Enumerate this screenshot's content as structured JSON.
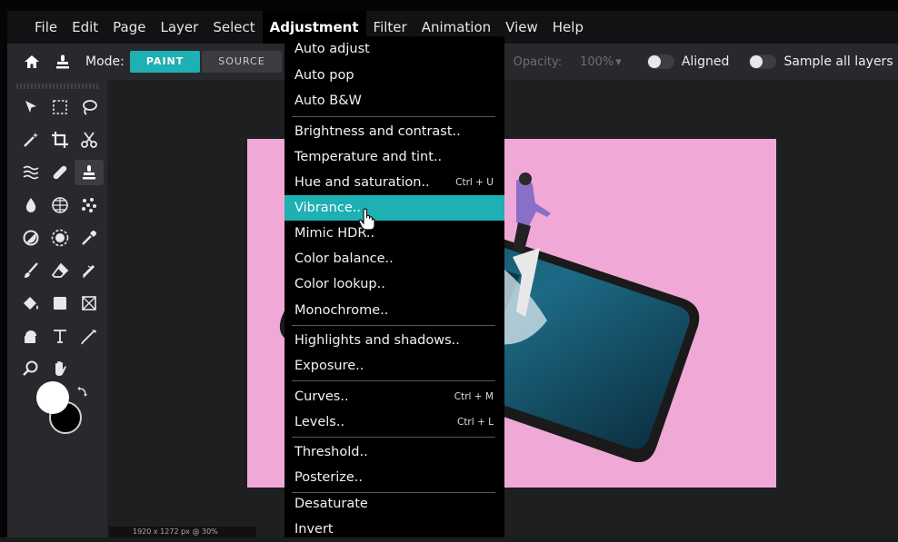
{
  "menubar": {
    "items": [
      "File",
      "Edit",
      "Page",
      "Layer",
      "Select",
      "Adjustment",
      "Filter",
      "Animation",
      "View",
      "Help"
    ],
    "active": "Adjustment"
  },
  "toolbar": {
    "home_icon": "home-icon",
    "clone_icon": "clone-stamp-icon",
    "mode_label": "Mode:",
    "mode_paint": "PAINT",
    "mode_source": "SOURCE",
    "opacity_label": "Opacity:",
    "opacity_value": "100%",
    "aligned_label": "Aligned",
    "sample_label": "Sample all layers"
  },
  "tools": [
    "move-icon",
    "marquee-icon",
    "lasso-icon",
    "magic-wand-icon",
    "crop-icon",
    "scissors-icon",
    "liquify-icon",
    "heal-icon",
    "clone-stamp-icon",
    "blur-icon",
    "sponge-icon",
    "noise-icon",
    "dodge-icon",
    "burn-icon",
    "eyedropper-icon",
    "brush-icon",
    "eraser-icon",
    "pencil-icon",
    "fill-icon",
    "shape-icon",
    "frame-icon",
    "gradient-icon",
    "text-icon",
    "pen-icon",
    "zoom-icon",
    "hand-icon"
  ],
  "colors": {
    "foreground": "#ffffff",
    "background": "#000000",
    "accent": "#1eb0b3",
    "canvas_bg": "#f0a9d6"
  },
  "status": {
    "text": "1920 x 1272 px @ 30%"
  },
  "adjustment_menu": {
    "items": [
      {
        "label": "Auto adjust",
        "shortcut": ""
      },
      {
        "label": "Auto pop",
        "shortcut": ""
      },
      {
        "label": "Auto B&W",
        "shortcut": ""
      },
      {
        "label": "Brightness and contrast..",
        "shortcut": ""
      },
      {
        "label": "Temperature and tint..",
        "shortcut": ""
      },
      {
        "label": "Hue and saturation..",
        "shortcut": "Ctrl + U"
      },
      {
        "label": "Vibrance..",
        "shortcut": ""
      },
      {
        "label": "Mimic HDR..",
        "shortcut": ""
      },
      {
        "label": "Color balance..",
        "shortcut": ""
      },
      {
        "label": "Color lookup..",
        "shortcut": ""
      },
      {
        "label": "Monochrome..",
        "shortcut": ""
      },
      {
        "label": "Highlights and shadows..",
        "shortcut": ""
      },
      {
        "label": "Exposure..",
        "shortcut": ""
      },
      {
        "label": "Curves..",
        "shortcut": "Ctrl + M"
      },
      {
        "label": "Levels..",
        "shortcut": "Ctrl + L"
      },
      {
        "label": "Threshold..",
        "shortcut": ""
      },
      {
        "label": "Posterize..",
        "shortcut": ""
      },
      {
        "label": "Desaturate",
        "shortcut": ""
      },
      {
        "label": "Invert",
        "shortcut": ""
      }
    ],
    "highlighted": "Vibrance.."
  }
}
